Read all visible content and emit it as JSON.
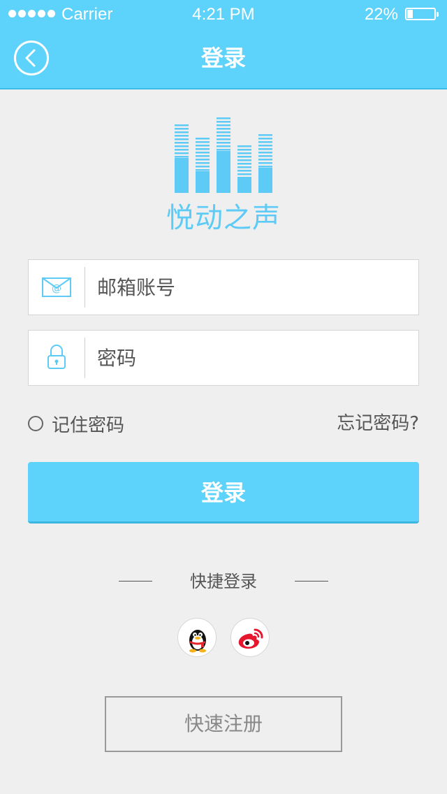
{
  "status_bar": {
    "carrier": "Carrier",
    "time": "4:21 PM",
    "battery_text": "22%",
    "battery_level": 0.22
  },
  "nav": {
    "title": "登录",
    "back_icon": "chevron-left-icon"
  },
  "logo": {
    "icon": "equalizer-bars-icon",
    "app_name": "悦动之声"
  },
  "form": {
    "email_placeholder": "邮箱账号",
    "email_icon": "envelope-icon",
    "password_placeholder": "密码",
    "password_icon": "lock-icon",
    "remember_label": "记住密码",
    "forgot_label": "忘记密码?"
  },
  "login_button": "登录",
  "quick_login": {
    "title": "快捷登录",
    "providers": [
      {
        "icon": "qq-penguin-icon"
      },
      {
        "icon": "weibo-icon"
      }
    ]
  },
  "register_button": "快速注册",
  "colors": {
    "accent": "#5dd2fb",
    "background": "#efefef",
    "logo_blue": "#5dcbf6"
  }
}
